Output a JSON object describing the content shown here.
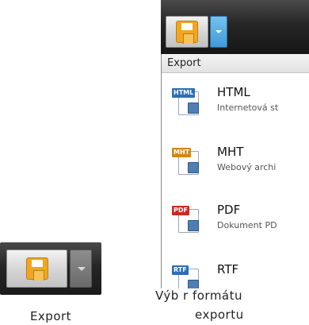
{
  "small_button": {
    "icon": "save-icon",
    "dropdown_icon": "chevron-down-icon",
    "caption": "Export"
  },
  "menu": {
    "header": "Export",
    "toolbar": {
      "save_icon": "save-icon",
      "dropdown_icon": "chevron-down-icon",
      "dropdown_color": "#4aa3e0"
    },
    "items": [
      {
        "badge": "HTML",
        "title": "HTML",
        "description": "Internetová st"
      },
      {
        "badge": "MHT",
        "title": "MHT",
        "description": "Webový archi"
      },
      {
        "badge": "PDF",
        "title": "PDF",
        "description": "Dokument PD"
      },
      {
        "badge": "RTF",
        "title": "RTF",
        "description": ""
      }
    ]
  },
  "captions": {
    "right_line1": "Výb r formátu",
    "right_line2": "exportu"
  }
}
